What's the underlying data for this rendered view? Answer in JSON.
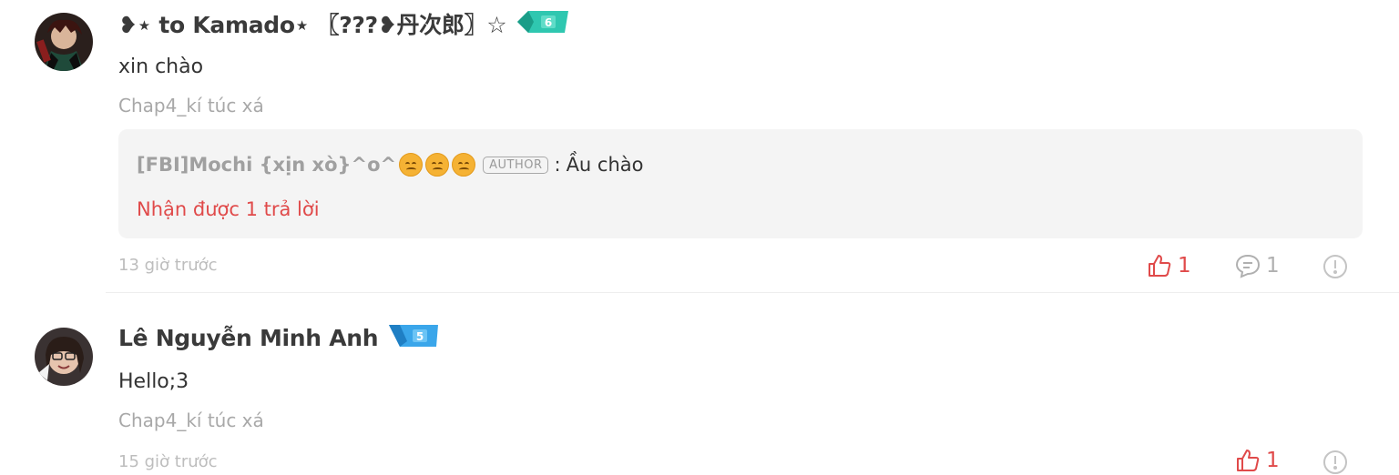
{
  "comments": [
    {
      "username": "❥⋆ to Kamado⋆ 〖???❥丹次郎〗☆",
      "badge_level": "6",
      "badge_color": "#2fc7b0",
      "content": "xin chào",
      "chapter": "Chap4_kí túc xá",
      "reply": {
        "author": "[FBI]Mochi {xịn xò}^o^",
        "author_tag": "AUTHOR",
        "separator": ":",
        "text": "Ầu chào",
        "reply_count_text": "Nhận được 1 trả lời"
      },
      "time": "13 giờ trước",
      "likes": "1",
      "replies": "1"
    },
    {
      "username": "Lê Nguyễn Minh Anh",
      "badge_level": "5",
      "badge_color": "#3aa6ea",
      "content": "Hello;3",
      "chapter": "Chap4_kí túc xá",
      "time": "15 giờ trước",
      "likes": "1"
    }
  ],
  "colors": {
    "like": "#e04a4a",
    "muted": "#bdbdbd",
    "reply_bg": "#f4f4f4"
  }
}
